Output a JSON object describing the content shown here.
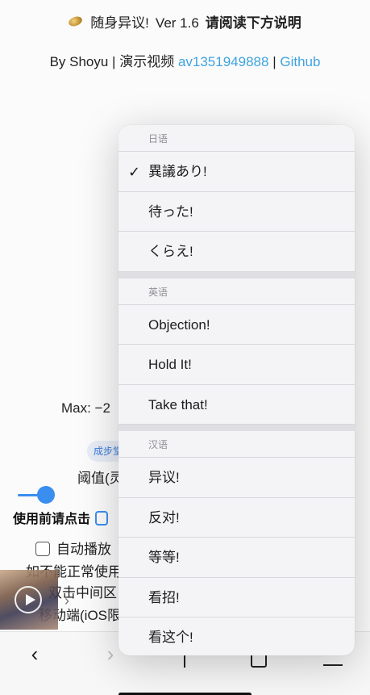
{
  "header": {
    "title": "随身异议!",
    "version": "Ver 1.6",
    "instruction": "请阅读下方说明",
    "by_prefix": "By Shoyu | 演示视频",
    "video_link": "av1351949888",
    "separator": "|",
    "github_link": "Github"
  },
  "page": {
    "max_label": "Max: −2",
    "pill_text": "成步堂",
    "threshold_label": "阈值(灵",
    "slider_fraction": 0.1,
    "use_note": "使用前请点击",
    "autoplay_label": "自动播放",
    "line1": "如不能正常使用",
    "line2": "双击中间区",
    "line3": "移动端(iOS限"
  },
  "menu": {
    "sections": [
      {
        "header": "日语",
        "items": [
          {
            "label": "異議あり!",
            "checked": true
          },
          {
            "label": "待った!",
            "checked": false
          },
          {
            "label": "くらえ!",
            "checked": false
          }
        ]
      },
      {
        "header": "英语",
        "items": [
          {
            "label": "Objection!",
            "checked": false
          },
          {
            "label": "Hold It!",
            "checked": false
          },
          {
            "label": "Take that!",
            "checked": false
          }
        ]
      },
      {
        "header": "汉语",
        "items": [
          {
            "label": "异议!",
            "checked": false
          },
          {
            "label": "反对!",
            "checked": false
          },
          {
            "label": "等等!",
            "checked": false
          },
          {
            "label": "看招!",
            "checked": false
          },
          {
            "label": "看这个!",
            "checked": false
          }
        ]
      }
    ],
    "check_glyph": "✓"
  },
  "toolbar": {
    "back_icon": "chevron-left-icon",
    "forward_icon": "chevron-right-icon",
    "share_icon": "share-icon",
    "tabs_icon": "tabs-icon",
    "menu_icon": "menu-icon"
  },
  "colors": {
    "link": "#3fa3e0",
    "accent": "#3a8ef0",
    "menu_bg": "#f4f4f6"
  }
}
